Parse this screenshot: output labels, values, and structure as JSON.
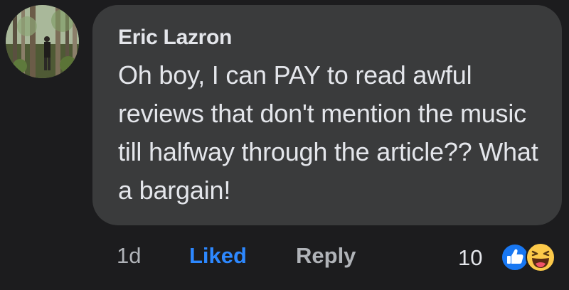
{
  "comment": {
    "author": "Eric Lazron",
    "text": "Oh boy, I can PAY to read awful reviews that don't mention the music till halfway through the article?? What a bargain!"
  },
  "actions": {
    "timestamp": "1d",
    "like_label": "Liked",
    "reply_label": "Reply"
  },
  "reactions": {
    "count": "10",
    "icons": [
      "like-icon",
      "haha-icon"
    ]
  },
  "colors": {
    "background": "#1c1c1e",
    "bubble": "#3a3b3c",
    "text": "#e4e6eb",
    "secondary_text": "#b0b3b8",
    "liked": "#2d88ff"
  }
}
